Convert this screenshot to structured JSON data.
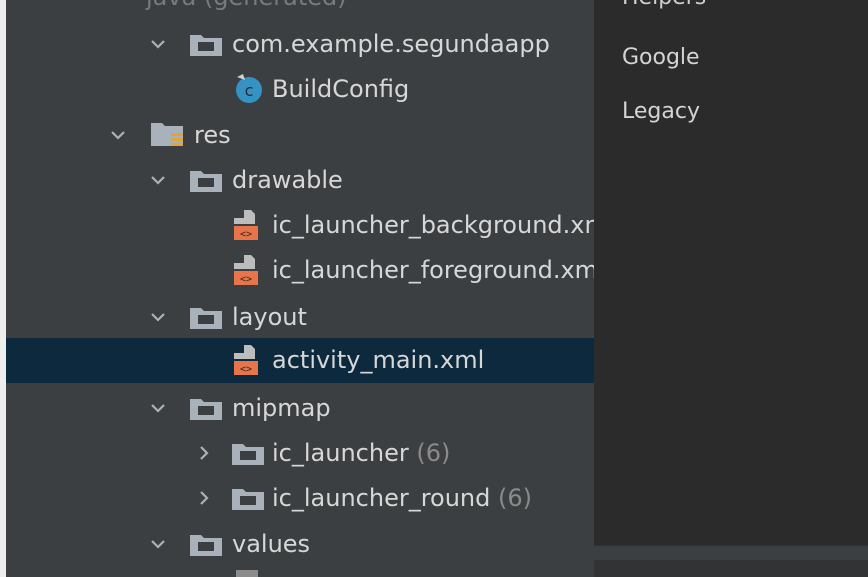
{
  "tree": {
    "top_partial": "java (generated)",
    "items": [
      {
        "label": "com.example.segundaapp",
        "count": "",
        "expanded": true,
        "icon": "package-folder-icon"
      },
      {
        "label": "BuildConfig",
        "count": "",
        "expanded": null,
        "icon": "class-c-icon"
      },
      {
        "label": "res",
        "count": "",
        "expanded": true,
        "icon": "resource-folder-icon"
      },
      {
        "label": "drawable",
        "count": "",
        "expanded": true,
        "icon": "folder-icon"
      },
      {
        "label": "ic_launcher_background.xml",
        "count": "",
        "expanded": null,
        "icon": "xml-file-icon"
      },
      {
        "label": "ic_launcher_foreground.xml",
        "count": "",
        "expanded": null,
        "icon": "xml-file-icon"
      },
      {
        "label": "layout",
        "count": "",
        "expanded": true,
        "icon": "folder-icon"
      },
      {
        "label": "activity_main.xml",
        "count": "",
        "expanded": null,
        "icon": "xml-file-icon",
        "selected": true
      },
      {
        "label": "mipmap",
        "count": "",
        "expanded": true,
        "icon": "folder-icon"
      },
      {
        "label": "ic_launcher",
        "count": "(6)",
        "expanded": false,
        "icon": "folder-icon"
      },
      {
        "label": "ic_launcher_round",
        "count": "(6)",
        "expanded": false,
        "icon": "folder-icon"
      },
      {
        "label": "values",
        "count": "",
        "expanded": true,
        "icon": "folder-icon"
      }
    ]
  },
  "side_panel": {
    "partial_top": "Helpers",
    "items": [
      "Google",
      "Legacy"
    ]
  },
  "colors": {
    "panel_bg": "#3c3f41",
    "editor_bg": "#2b2b2b",
    "selection": "#0d293e",
    "text": "#d7d7d7",
    "muted": "#8a8a8a",
    "folder_icon": "#a9b1ba",
    "class_icon": "#3592c4",
    "xml_icon": "#e8754a"
  }
}
